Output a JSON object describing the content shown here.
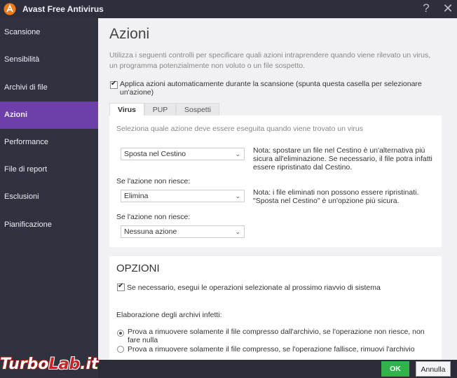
{
  "window": {
    "title": "Avast Free Antivirus",
    "help_glyph": "?",
    "close_glyph": "✕",
    "logo_icon": "avast-logo-icon",
    "accent_color": "#6d3fa8"
  },
  "sidebar": {
    "items": [
      {
        "label": "Scansione",
        "active": false
      },
      {
        "label": "Sensibilità",
        "active": false
      },
      {
        "label": "Archivi di file",
        "active": false
      },
      {
        "label": "Azioni",
        "active": true
      },
      {
        "label": "Performance",
        "active": false
      },
      {
        "label": "File di report",
        "active": false
      },
      {
        "label": "Esclusioni",
        "active": false
      },
      {
        "label": "Pianificazione",
        "active": false
      }
    ]
  },
  "main": {
    "title": "Azioni",
    "intro": "Utilizza i seguenti controlli per specificare quali azioni intraprendere quando viene rilevato un virus, un programma potenzialmente non voluto o un file sospetto.",
    "auto_apply": {
      "checked": true,
      "label": "Applica azioni automaticamente durante la scansione (spunta questa casella per selezionare un'azione)"
    },
    "tabs": [
      {
        "label": "Virus",
        "active": true
      },
      {
        "label": "PUP",
        "active": false
      },
      {
        "label": "Sospetti",
        "active": false
      }
    ],
    "panel": {
      "hint": "Seleziona quale azione deve essere eseguita quando viene trovato un virus",
      "primary_action": "Sposta nel Cestino",
      "primary_note": "Nota: spostare un file nel Cestino è un'alternativa più sicura all'eliminazione. Se necessario, il file potra infatti essere ripristinato dal Cestino.",
      "fail_label_1": "Se l'azione non riesce:",
      "fallback_action_1": "Elimina",
      "fallback_note_1": "Nota: i file eliminati non possono essere ripristinati. \"Sposta nel Cestino\" è un'opzione più sicura.",
      "fail_label_2": "Se l'azione non riesce:",
      "fallback_action_2": "Nessuna azione"
    },
    "options": {
      "heading": "OPZIONI",
      "reboot": {
        "checked": true,
        "label": "Se necessario, esegui le operazioni selezionate al prossimo riavvio di sistema"
      },
      "archives_label": "Elaborazione degli archivi infetti:",
      "radio_1": {
        "selected": true,
        "label": "Prova a rimuovere solamente il file compresso dall'archivio, se l'operazione non riesce, non fare nulla"
      },
      "radio_2": {
        "selected": false,
        "label": "Prova a rimuovere solamente il file compresso, se l'operazione fallisce, rimuovi l'archivio"
      }
    }
  },
  "footer": {
    "ok_label": "OK",
    "cancel_label": "Annulla",
    "ok_color": "#2fb34a"
  },
  "watermark": {
    "part1": "Turbo",
    "part2": "Lab",
    "part3": ".it"
  }
}
